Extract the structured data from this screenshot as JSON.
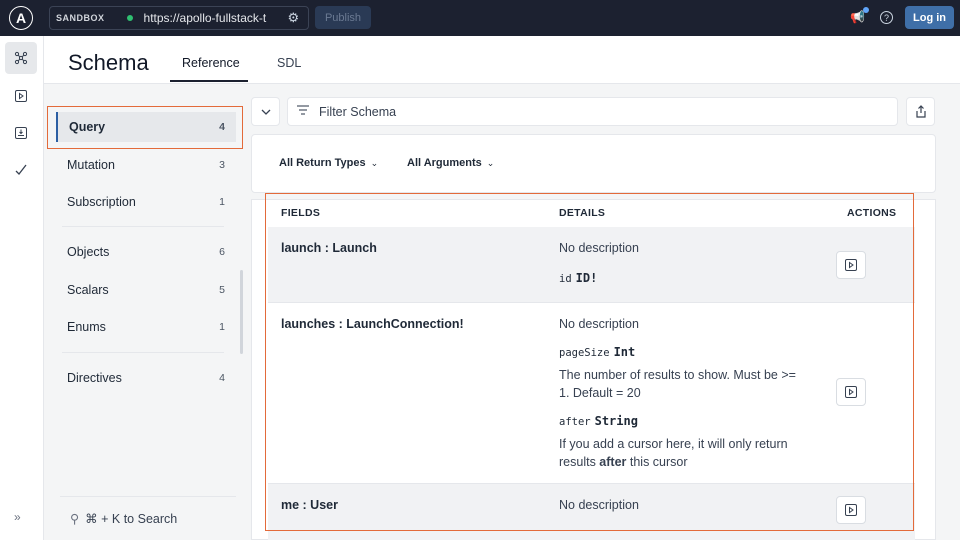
{
  "topbar": {
    "logo": "A",
    "sandbox_label": "SANDBOX",
    "url": "https://apollo-fullstack-t",
    "publish_label": "Publish",
    "login_label": "Log in"
  },
  "header": {
    "title": "Schema",
    "tabs": [
      {
        "label": "Reference",
        "active": true
      },
      {
        "label": "SDL",
        "active": false
      }
    ]
  },
  "sidebar": {
    "items": [
      {
        "label": "Query",
        "count": "4",
        "active": true
      },
      {
        "label": "Mutation",
        "count": "3"
      },
      {
        "label": "Subscription",
        "count": "1"
      },
      {
        "label": "Objects",
        "count": "6"
      },
      {
        "label": "Scalars",
        "count": "5"
      },
      {
        "label": "Enums",
        "count": "1"
      },
      {
        "label": "Directives",
        "count": "4"
      }
    ],
    "search_hint": "⌘ + K to Search"
  },
  "filter": {
    "placeholder": "Filter Schema",
    "return_types_label": "All Return Types",
    "arguments_label": "All Arguments"
  },
  "table": {
    "headers": {
      "fields": "FIELDS",
      "details": "DETAILS",
      "actions": "ACTIONS"
    },
    "rows": [
      {
        "field": "launch : Launch",
        "description": "No description",
        "args": [
          {
            "name": "id",
            "type": "ID!",
            "description": ""
          }
        ]
      },
      {
        "field": "launches : LaunchConnection!",
        "description": "No description",
        "args": [
          {
            "name": "pageSize",
            "type": "Int",
            "description": "The number of results to show. Must be >= 1. Default = 20"
          },
          {
            "name": "after",
            "type": "String",
            "description_pre": "If you add a cursor here, it will only return results ",
            "description_bold": "after",
            "description_post": " this cursor"
          }
        ]
      },
      {
        "field": "me : User",
        "description": "No description",
        "args": []
      }
    ]
  },
  "colors": {
    "topbar_bg": "#1c2130",
    "highlight": "#e36a3a",
    "active_accent": "#2d5fa3",
    "login_bg": "#3f6fa8",
    "status_dot": "#2fbf71"
  },
  "icons": {
    "rail": [
      "schema-icon",
      "play-icon",
      "checklist-icon",
      "check-icon"
    ],
    "expand": "double-chevron-right-icon"
  }
}
